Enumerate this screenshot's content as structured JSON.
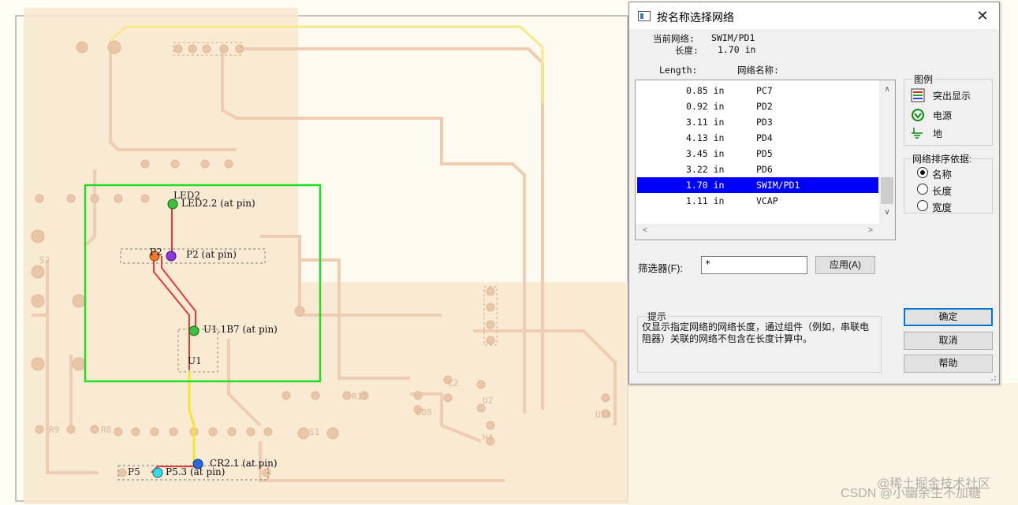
{
  "dialog": {
    "title": "按名称选择网络",
    "close_glyph": "✕",
    "current_net_label": "当前网络:",
    "current_net_value": "SWIM/PD1",
    "length_label": "长度:",
    "length_value": "1.70 in",
    "col_length": "Length:",
    "col_netname": "网络名称:",
    "nets": [
      {
        "length": "0.85 in",
        "name": "PC7"
      },
      {
        "length": "0.92 in",
        "name": "PD2"
      },
      {
        "length": "3.11 in",
        "name": "PD3"
      },
      {
        "length": "4.13 in",
        "name": "PD4"
      },
      {
        "length": "3.45 in",
        "name": "PD5"
      },
      {
        "length": "3.22 in",
        "name": "PD6"
      },
      {
        "length": "1.70 in",
        "name": "SWIM/PD1"
      },
      {
        "length": "1.11 in",
        "name": "VCAP"
      }
    ],
    "selected_index": 6,
    "legend": {
      "title": "图例",
      "highlight": "突出显示",
      "power": "电源",
      "ground": "地"
    },
    "sort": {
      "title": "网络排序依据:",
      "by_name": "名称",
      "by_length": "长度",
      "by_width": "宽度",
      "selected": "by_name"
    },
    "filter_label": "筛选器(F):",
    "filter_value": "*",
    "apply_button": "应用(A)",
    "hint_title": "提示",
    "hint_text": "仅显示指定网络的网络长度，通过组件（例如，串联电阻器）关联的网络不包含在长度计算中。",
    "ok_button": "确定",
    "cancel_button": "取消",
    "help_button": "帮助"
  },
  "pcb": {
    "labels": {
      "led2": "LED2",
      "led2_pin": "LED2.2 (at pin)",
      "p2": "P2",
      "p2_pin": "P2 (at pin)",
      "u1_pin": "U1.1B7 (at pin)",
      "u1": "U1",
      "cr2_pin": "CR2.1 (at pin)",
      "p5": "P5",
      "p5_pin": "P5.3 (at pin)",
      "s2": "S2",
      "u2": "U2",
      "u10": "U10",
      "c2": "C2",
      "ed5": "ED5",
      "s1": "S1",
      "r8": "R8",
      "r9": "R9",
      "r11": "R11",
      "h4": "H4"
    }
  },
  "watermark": {
    "site": "@稀土掘金技术社区",
    "author": "CSDN @小幽余生不加糖"
  }
}
